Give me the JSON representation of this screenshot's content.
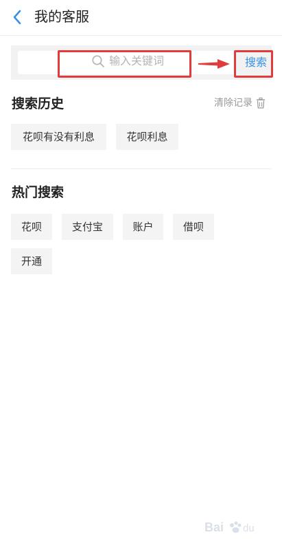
{
  "header": {
    "title": "我的客服"
  },
  "search": {
    "placeholder": "输入关键词",
    "button_label": "搜索"
  },
  "history": {
    "title": "搜索历史",
    "clear_label": "清除记录",
    "items": [
      "花呗有没有利息",
      "花呗利息"
    ]
  },
  "hot": {
    "title": "热门搜索",
    "items": [
      "花呗",
      "支付宝",
      "账户",
      "借呗",
      "开通"
    ]
  },
  "colors": {
    "accent": "#3891e6",
    "annotation": "#e23b3b",
    "tag_bg": "#f4f4f4"
  },
  "icons": {
    "back": "chevron-left-icon",
    "search": "search-icon",
    "clear": "trash-icon"
  }
}
